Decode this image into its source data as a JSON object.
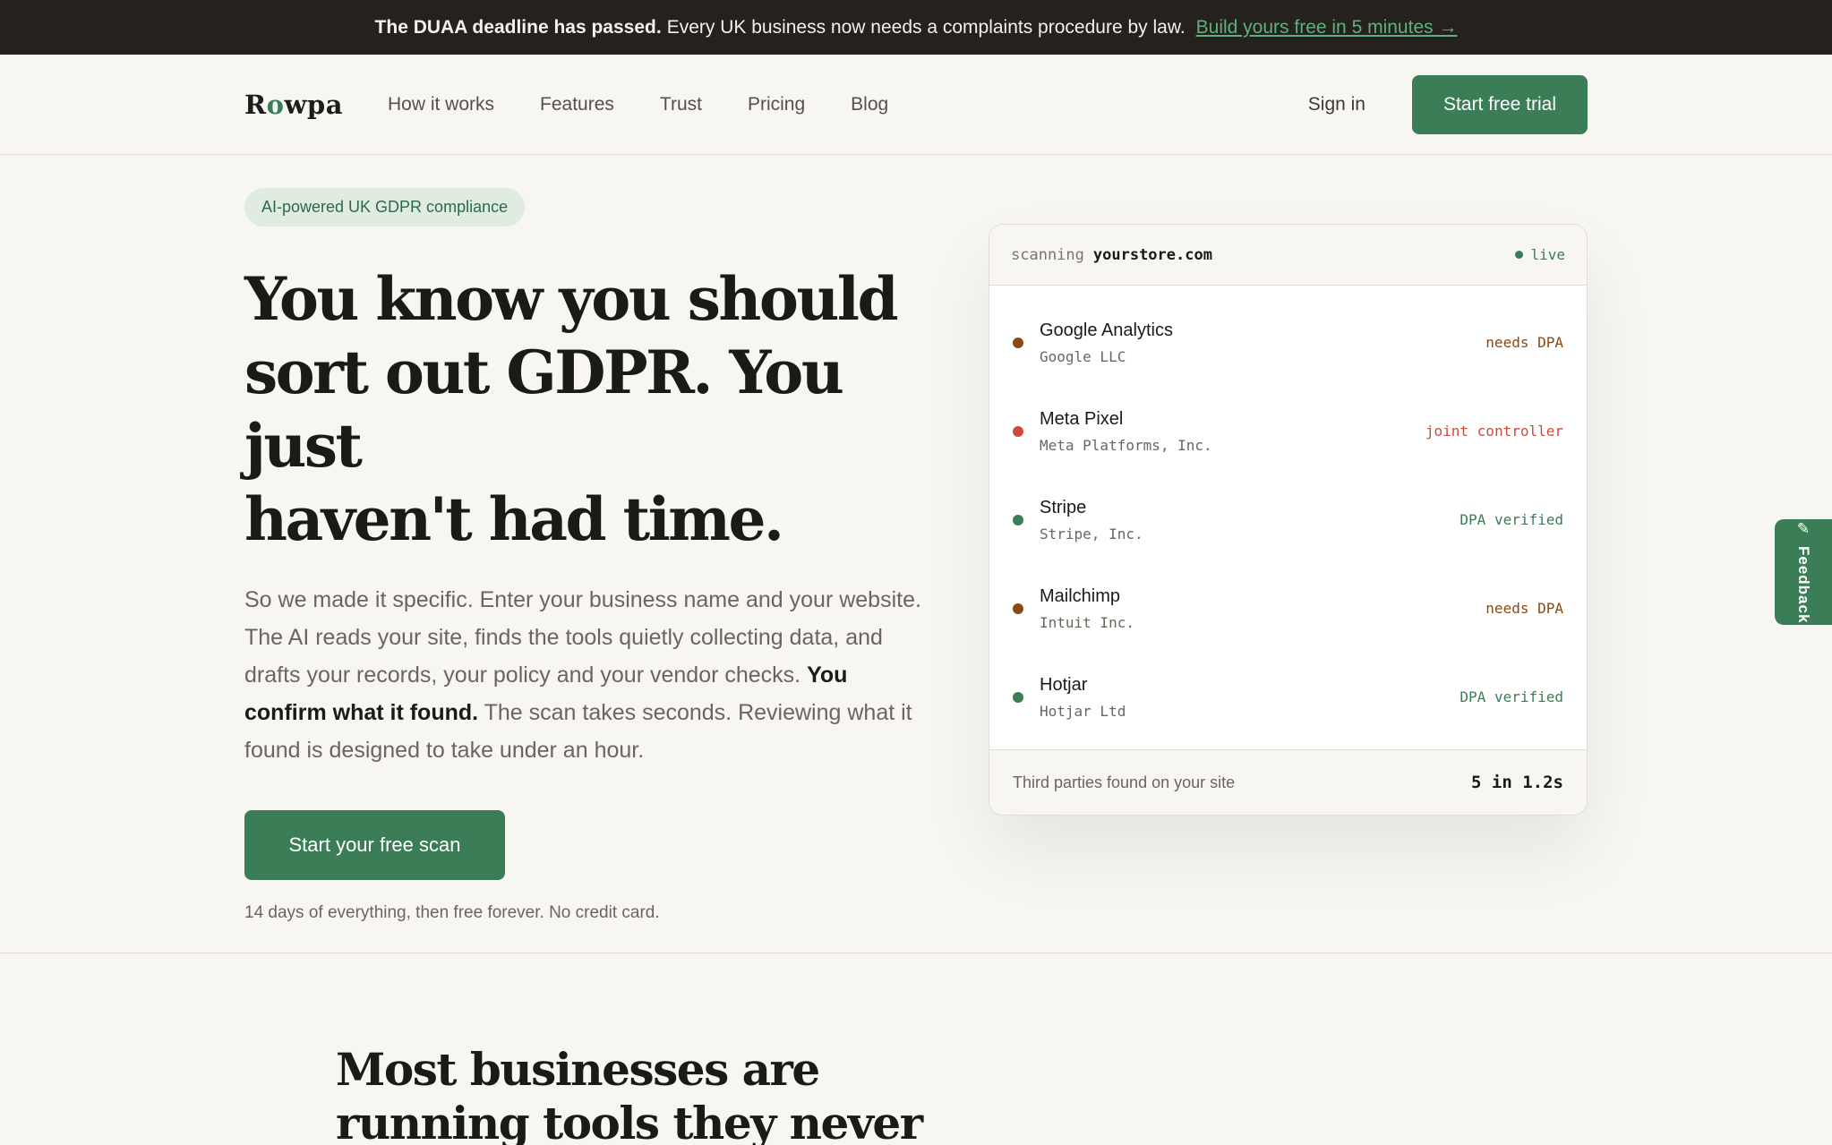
{
  "announcement": {
    "bold": "The DUAA deadline has passed.",
    "text": "Every UK business now needs a complaints procedure by law.",
    "link": "Build yours free in 5 minutes →"
  },
  "nav": {
    "logo_r": "R",
    "logo_o": "o",
    "logo_rest": "wpa",
    "links": [
      "How it works",
      "Features",
      "Trust",
      "Pricing",
      "Blog"
    ],
    "signin": "Sign in",
    "cta": "Start free trial"
  },
  "hero": {
    "pill": "AI-powered UK GDPR compliance",
    "headline_1": "You know you should",
    "headline_2": "sort out GDPR. You just",
    "headline_3": "haven't had time.",
    "lede_a": "So we made it specific. Enter your business name and your website. The AI reads your site, finds the tools quietly collecting data, and drafts your records, your policy and your vendor checks.",
    "lede_bold": "You confirm what it found.",
    "lede_b": "The scan takes seconds. Reviewing what it found is designed to take under an hour.",
    "cta": "Start your free scan",
    "fineprint": "14 days of everything, then free forever. No credit card."
  },
  "scan_card": {
    "scanning": "scanning",
    "domain": "yourstore.com",
    "live": "live",
    "rows": [
      {
        "name": "Google Analytics",
        "company": "Google LLC",
        "status": "needs DPA",
        "color": "#8a4a12"
      },
      {
        "name": "Meta Pixel",
        "company": "Meta Platforms, Inc.",
        "status": "joint controller",
        "color": "#d04a3c"
      },
      {
        "name": "Stripe",
        "company": "Stripe, Inc.",
        "status": "DPA verified",
        "color": "#3b7d57"
      },
      {
        "name": "Mailchimp",
        "company": "Intuit Inc.",
        "status": "needs DPA",
        "color": "#8a4a12"
      },
      {
        "name": "Hotjar",
        "company": "Hotjar Ltd",
        "status": "DPA verified",
        "color": "#3b7d57"
      }
    ],
    "footer_label": "Third parties found on your site",
    "footer_count": "5 in 1.2s"
  },
  "section": {
    "title": "Most businesses are running tools they never"
  },
  "feedback": {
    "label": "Feedback",
    "icon": "pencil-icon"
  },
  "colors": {
    "brand_green": "#3b7d57",
    "dark_bar": "#25221d",
    "page_bg": "#f7f6f2"
  }
}
